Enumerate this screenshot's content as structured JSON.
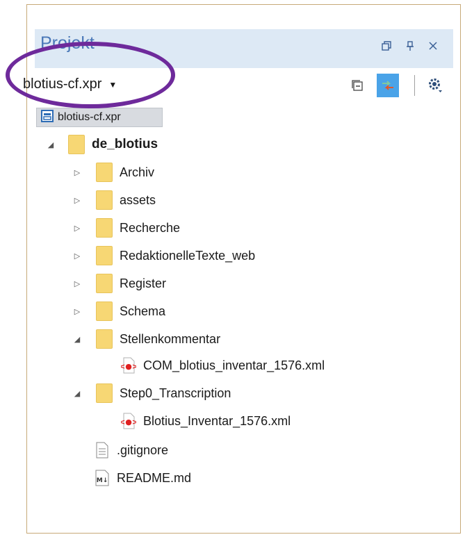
{
  "panel": {
    "title": "Projekt",
    "project_file": "blotius-cf.xpr",
    "tab_label": "blotius-cf.xpr"
  },
  "icons": {
    "restore": "restore-window-icon",
    "pin": "pin-icon",
    "close": "close-icon",
    "collapse_all": "collapse-all-icon",
    "link_editor": "link-with-editor-icon",
    "settings": "gear-icon"
  },
  "colors": {
    "header_bg": "#dde9f5",
    "title_text": "#4a78b8",
    "folder": "#f7d774",
    "annotation_ring": "#6e2a9b",
    "frame_border": "#c7a978",
    "link_button_bg": "#4aa3e8"
  },
  "tree": {
    "root": {
      "label": "de_blotius",
      "expanded": true
    },
    "items": [
      {
        "label": "Archiv",
        "type": "folder",
        "expanded": false
      },
      {
        "label": "assets",
        "type": "folder",
        "expanded": false
      },
      {
        "label": "Recherche",
        "type": "folder",
        "expanded": false
      },
      {
        "label": "RedaktionelleTexte_web",
        "type": "folder",
        "expanded": false
      },
      {
        "label": "Register",
        "type": "folder",
        "expanded": false
      },
      {
        "label": "Schema",
        "type": "folder",
        "expanded": false
      },
      {
        "label": "Stellenkommentar",
        "type": "folder",
        "expanded": true
      },
      {
        "label": "COM_blotius_inventar_1576.xml",
        "type": "xml"
      },
      {
        "label": "Step0_Transcription",
        "type": "folder",
        "expanded": true
      },
      {
        "label": "Blotius_Inventar_1576.xml",
        "type": "xml"
      },
      {
        "label": ".gitignore",
        "type": "text"
      },
      {
        "label": "README.md",
        "type": "markdown",
        "icon_text": "M↓"
      }
    ]
  }
}
